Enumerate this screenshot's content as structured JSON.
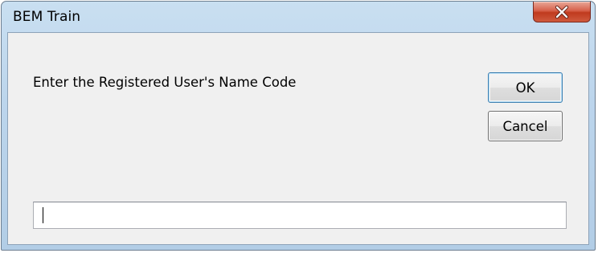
{
  "window": {
    "title": "BEM Train"
  },
  "titlebar": {
    "close_icon": "close-icon"
  },
  "dialog": {
    "prompt": "Enter the Registered User's Name Code",
    "ok_label": "OK",
    "cancel_label": "Cancel",
    "input_value": ""
  },
  "colors": {
    "titlebar": "#bcd5ec",
    "close_button": "#c03a1e",
    "client_background": "#f0f0f0",
    "default_button_border": "#3c7fb1"
  }
}
